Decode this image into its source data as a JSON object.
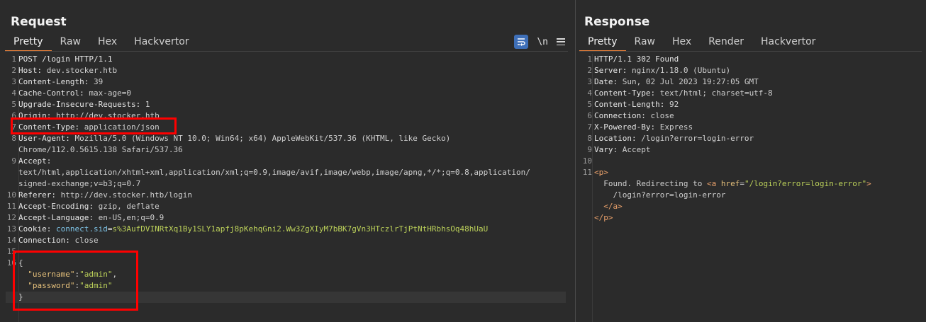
{
  "request": {
    "title": "Request",
    "tabs": [
      "Pretty",
      "Raw",
      "Hex",
      "Hackvertor"
    ],
    "active_tab": "Pretty",
    "toolbar": {
      "newline_label": "\\n"
    },
    "lines": [
      {
        "n": "1",
        "key": "POST /login HTTP/1.1",
        "sep": "",
        "val": ""
      },
      {
        "n": "2",
        "key": "Host",
        "sep": ": ",
        "val": "dev.stocker.htb"
      },
      {
        "n": "3",
        "key": "Content-Length",
        "sep": ": ",
        "val": "39"
      },
      {
        "n": "4",
        "key": "Cache-Control",
        "sep": ": ",
        "val": "max-age=0"
      },
      {
        "n": "5",
        "key": "Upgrade-Insecure-Requests",
        "sep": ": ",
        "val": "1"
      },
      {
        "n": "6",
        "key": "Origin",
        "sep": ": ",
        "val": "http://dev.stocker.htb"
      },
      {
        "n": "7",
        "key": "Content-Type",
        "sep": ": ",
        "val": "application/json"
      },
      {
        "n": "8",
        "key": "User-Agent",
        "sep": ": ",
        "val": "Mozilla/5.0 (Windows NT 10.0; Win64; x64) AppleWebKit/537.36 (KHTML, like Gecko)"
      },
      {
        "n": "",
        "key": "",
        "sep": "",
        "val": "Chrome/112.0.5615.138 Safari/537.36"
      },
      {
        "n": "9",
        "key": "Accept",
        "sep": ":",
        "val": ""
      },
      {
        "n": "",
        "key": "",
        "sep": "",
        "val": "text/html,application/xhtml+xml,application/xml;q=0.9,image/avif,image/webp,image/apng,*/*;q=0.8,application/"
      },
      {
        "n": "",
        "key": "",
        "sep": "",
        "val": "signed-exchange;v=b3;q=0.7"
      },
      {
        "n": "10",
        "key": "Referer",
        "sep": ": ",
        "val": "http://dev.stocker.htb/login"
      },
      {
        "n": "11",
        "key": "Accept-Encoding",
        "sep": ": ",
        "val": "gzip, deflate"
      },
      {
        "n": "12",
        "key": "Accept-Language",
        "sep": ": ",
        "val": "en-US,en;q=0.9"
      }
    ],
    "cookie": {
      "n": "13",
      "key": "Cookie",
      "name": "connect.sid",
      "eq": "=",
      "value": "s%3AufDVINRtXq1By1SLY1apfj8pKehqGni2.Ww3ZgXIyM7bBK7gVn3HTczlrTjPtNtHRbhsOq48hUaU"
    },
    "connection": {
      "n": "14",
      "key": "Connection",
      "val": "close"
    },
    "blank_line_n": "15",
    "body": {
      "n": "16",
      "open": "{",
      "close": "}",
      "fields": [
        {
          "key": "\"username\"",
          "colon": ":",
          "val": "\"admin\"",
          "comma": ","
        },
        {
          "key": "\"password\"",
          "colon": ":",
          "val": "\"admin\"",
          "comma": ""
        }
      ]
    }
  },
  "response": {
    "title": "Response",
    "tabs": [
      "Pretty",
      "Raw",
      "Hex",
      "Render",
      "Hackvertor"
    ],
    "active_tab": "Pretty",
    "lines": [
      {
        "n": "1",
        "key": "HTTP/1.1 302 Found",
        "sep": "",
        "val": ""
      },
      {
        "n": "2",
        "key": "Server",
        "sep": ": ",
        "val": "nginx/1.18.0 (Ubuntu)"
      },
      {
        "n": "3",
        "key": "Date",
        "sep": ": ",
        "val": "Sun, 02 Jul 2023 19:27:05 GMT"
      },
      {
        "n": "4",
        "key": "Content-Type",
        "sep": ": ",
        "val": "text/html; charset=utf-8"
      },
      {
        "n": "5",
        "key": "Content-Length",
        "sep": ": ",
        "val": "92"
      },
      {
        "n": "6",
        "key": "Connection",
        "sep": ": ",
        "val": "close"
      },
      {
        "n": "7",
        "key": "X-Powered-By",
        "sep": ": ",
        "val": "Express"
      },
      {
        "n": "8",
        "key": "Location",
        "sep": ": ",
        "val": "/login?error=login-error"
      },
      {
        "n": "9",
        "key": "Vary",
        "sep": ": ",
        "val": "Accept"
      },
      {
        "n": "10",
        "key": "",
        "sep": "",
        "val": ""
      }
    ],
    "html_body": {
      "n": "11",
      "p_open": "<p>",
      "text": "Found. Redirecting to ",
      "a_open_start": "<a ",
      "href_attr": "href",
      "href_eq": "=",
      "href_val": "\"/login?error=login-error\"",
      "a_open_end": ">",
      "link_text": "/login?error=login-error",
      "a_close": "</a>",
      "p_close": "</p>"
    }
  }
}
